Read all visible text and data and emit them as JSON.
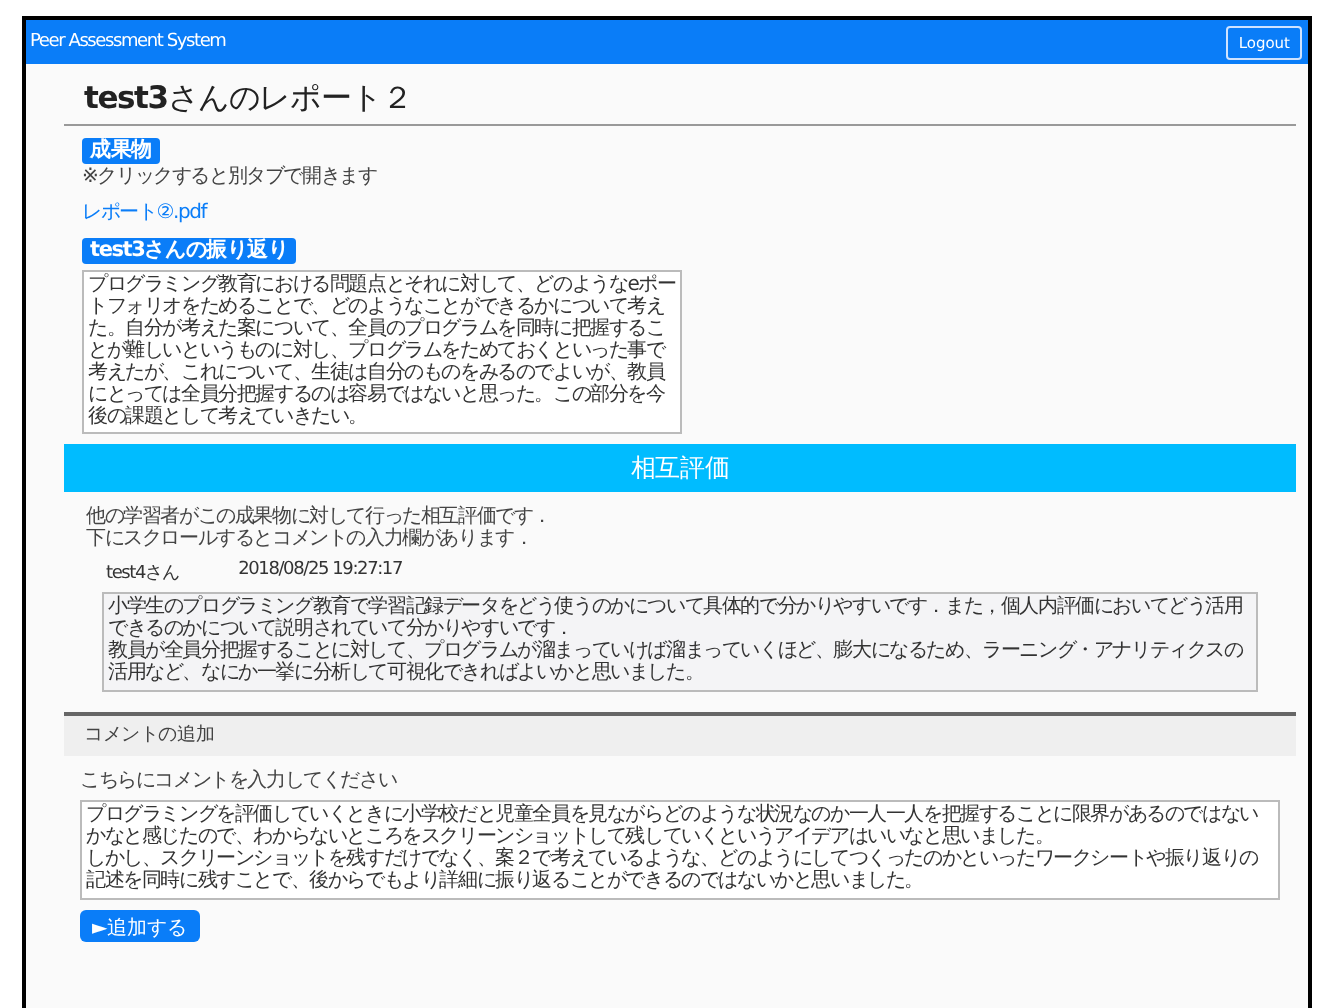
{
  "navbar": {
    "brand": "Peer Assessment System",
    "logout": "Logout"
  },
  "page_title": "**test3**さんのレポート２",
  "deliverable": {
    "heading": "成果物",
    "note": "※クリックすると別タブで開きます",
    "link": "レポート②.pdf"
  },
  "reflection": {
    "heading": "test3さんの振り返り",
    "text": "プログラミング教育における問題点とそれに対して、どのようなeポートフォリオをためることで、どのようなことができるかについて考えた。自分が考えた案について、全員のプログラムを同時に把握することが難しいというものに対し、プログラムをためておくといった事で考えたが、これについて、生徒は自分のものをみるのでよいが、教員にとっては全員分把握するのは容易ではないと思った。この部分を今後の課題として考えていきたい。"
  },
  "peer_review": {
    "title": "相互評価",
    "intro": [
      "他の学習者がこの成果物に対して行った相互評価です．",
      "下にスクロールするとコメントの入力欄があります．"
    ],
    "comments": [
      {
        "author": "test4さん",
        "date": "2018/08/25 19:27:17",
        "paragraphs": [
          "小学生のプログラミング教育で学習記録データをどう使うのかについて具体的で分かりやすいです．また，個人内評価においてどう活用できるのかについて説明されていて分かりやすいです．",
          "教員が全員分把握することに対して、プログラムが溜まっていけば溜まっていくほど、膨大になるため、ラーニング・アナリティクスの活用など、なにか一挙に分析して可視化できればよいかと思いました。"
        ]
      }
    ]
  },
  "add_comment": {
    "title": "コメントの追加",
    "label": "こちらにコメントを入力してください",
    "value": [
      "プログラミングを評価していくときに小学校だと児童全員を見ながらどのような状況なのか一人一人を把握することに限界があるのではないかなと感じたので、わからないところをスクリーンショットして残していくというアイデアはいいなと思いました。",
      "しかし、スクリーンショットを残すだけでなく、案２で考えているような、どのようにしてつくったのかといったワークシートや振り返りの記述を同時に残すことで、後からでもより詳細に振り返ることができるのではないかと思いました。"
    ],
    "button": "►追加する"
  }
}
